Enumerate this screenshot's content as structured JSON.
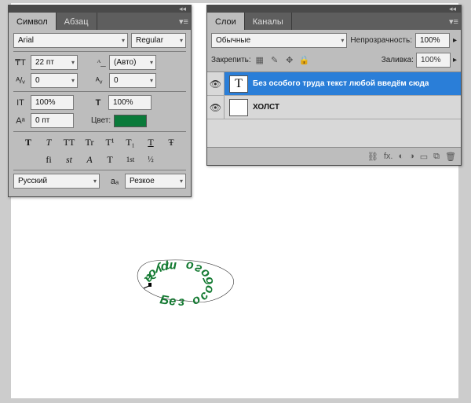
{
  "char_panel": {
    "tabs": {
      "active": "Символ",
      "inactive": "Абзац"
    },
    "font_family": "Arial",
    "font_style": "Regular",
    "font_size": "22 пт",
    "leading": "(Авто)",
    "kerning": "0",
    "tracking": "0",
    "vscale": "100%",
    "hscale": "100%",
    "baseline": "0 пт",
    "color_label": "Цвет:",
    "text_color": "#0a7a3a",
    "style_buttons": [
      "T",
      "T",
      "TT",
      "Tr",
      "T¹",
      "T₁",
      "T",
      "Ŧ"
    ],
    "opentype_buttons": [
      "fi",
      "st",
      "A",
      "T",
      "1st",
      "½"
    ],
    "language": "Русский",
    "aa_label": "aₐ",
    "aa_mode": "Резкое"
  },
  "layers_panel": {
    "tabs": {
      "active": "Слои",
      "inactive": "Каналы"
    },
    "blend_mode": "Обычные",
    "opacity_label": "Непрозрачность:",
    "opacity_value": "100%",
    "lock_label": "Закрепить:",
    "fill_label": "Заливка:",
    "fill_value": "100%",
    "layers": [
      {
        "thumb": "T",
        "name": "Без особого труда текст любой введём сюда",
        "selected": true
      },
      {
        "thumb": "",
        "name": "ХОЛСТ",
        "selected": false
      }
    ]
  },
  "canvas": {
    "path_text_color": "#147a32"
  }
}
